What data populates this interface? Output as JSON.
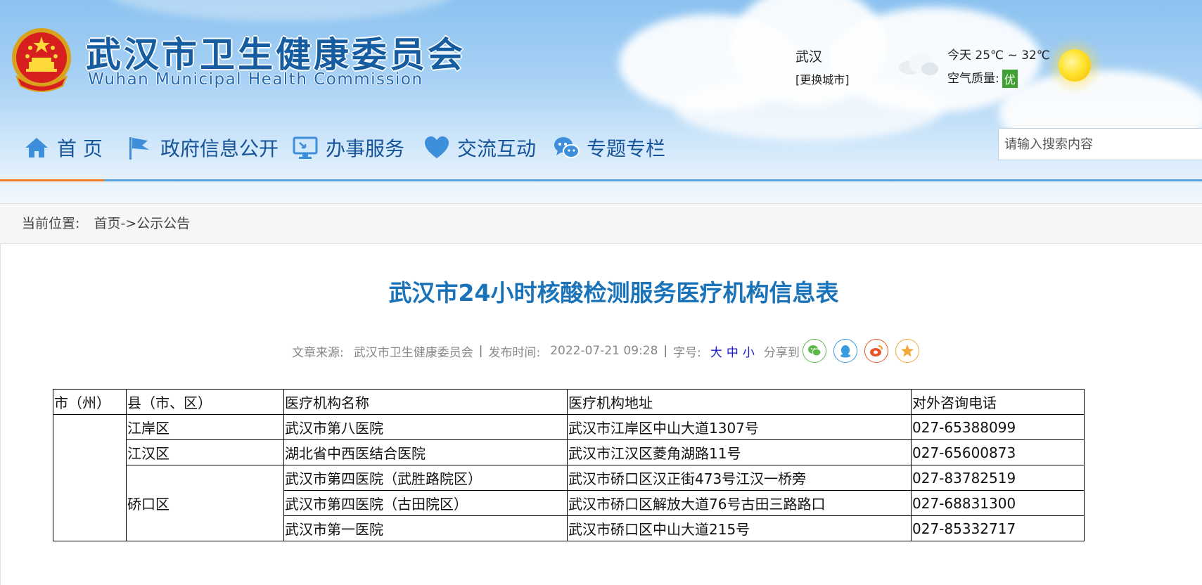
{
  "header": {
    "site_title": "武汉市卫生健康委员会",
    "site_subtitle": "Wuhan Municipal Health Commission",
    "emblem_icon": "national-emblem-icon"
  },
  "weather": {
    "city": "武汉",
    "change_city": "[更换城市]",
    "temp": "今天  25℃ ~ 32℃",
    "air_quality_label": "空气质量:",
    "air_quality_value": "优",
    "icons": [
      "cloud-icon",
      "sun-icon"
    ]
  },
  "nav": {
    "items": [
      {
        "label": "首  页",
        "icon": "home-icon"
      },
      {
        "label": "政府信息公开",
        "icon": "flag-icon"
      },
      {
        "label": "办事服务",
        "icon": "monitor-icon"
      },
      {
        "label": "交流互动",
        "icon": "heart-icon"
      },
      {
        "label": "专题专栏",
        "icon": "chat-icon"
      }
    ],
    "search_placeholder": "请输入搜索内容"
  },
  "breadcrumb": {
    "label": "当前位置:",
    "home": "首页",
    "arrow": "->",
    "current": "公示公告"
  },
  "article": {
    "title": "武汉市24小时核酸检测服务医疗机构信息表",
    "source_label": "文章来源:",
    "source": "武汉市卫生健康委员会",
    "sep": "|",
    "publish_label": "发布时间:",
    "publish_time": "2022-07-21 09:28",
    "font_label": "字号:",
    "font_sizes": [
      "大",
      "中",
      "小"
    ],
    "share_label": "分享到",
    "share_icons": [
      "wechat-icon",
      "qq-icon",
      "weibo-icon",
      "favorite-star-icon"
    ]
  },
  "table": {
    "headers": [
      "市（州）",
      "县（市、区）",
      "医疗机构名称",
      "医疗机构地址",
      "对外咨询电话"
    ],
    "districts": [
      "江岸区",
      "江汉区",
      "硚口区"
    ],
    "rows": [
      {
        "name": "武汉市第八医院",
        "address": "武汉市江岸区中山大道1307号",
        "phone": "027-65388099"
      },
      {
        "name": "湖北省中西医结合医院",
        "address": "武汉市江汉区菱角湖路11号",
        "phone": "027-65600873"
      },
      {
        "name": "武汉市第四医院（武胜路院区）",
        "address": "武汉市硚口区汉正街473号江汉一桥旁",
        "phone": "027-83782519"
      },
      {
        "name": "武汉市第四医院（古田院区）",
        "address": "武汉市硚口区解放大道76号古田三路路口",
        "phone": "027-68831300"
      },
      {
        "name": "武汉市第一医院",
        "address": "武汉市硚口区中山大道215号",
        "phone": "027-85332717"
      }
    ]
  },
  "colors": {
    "title_blue": "#155ca0",
    "article_title": "#1a73b8",
    "nav_orange": "#f07c2a",
    "aqi_green": "#3fa232"
  }
}
